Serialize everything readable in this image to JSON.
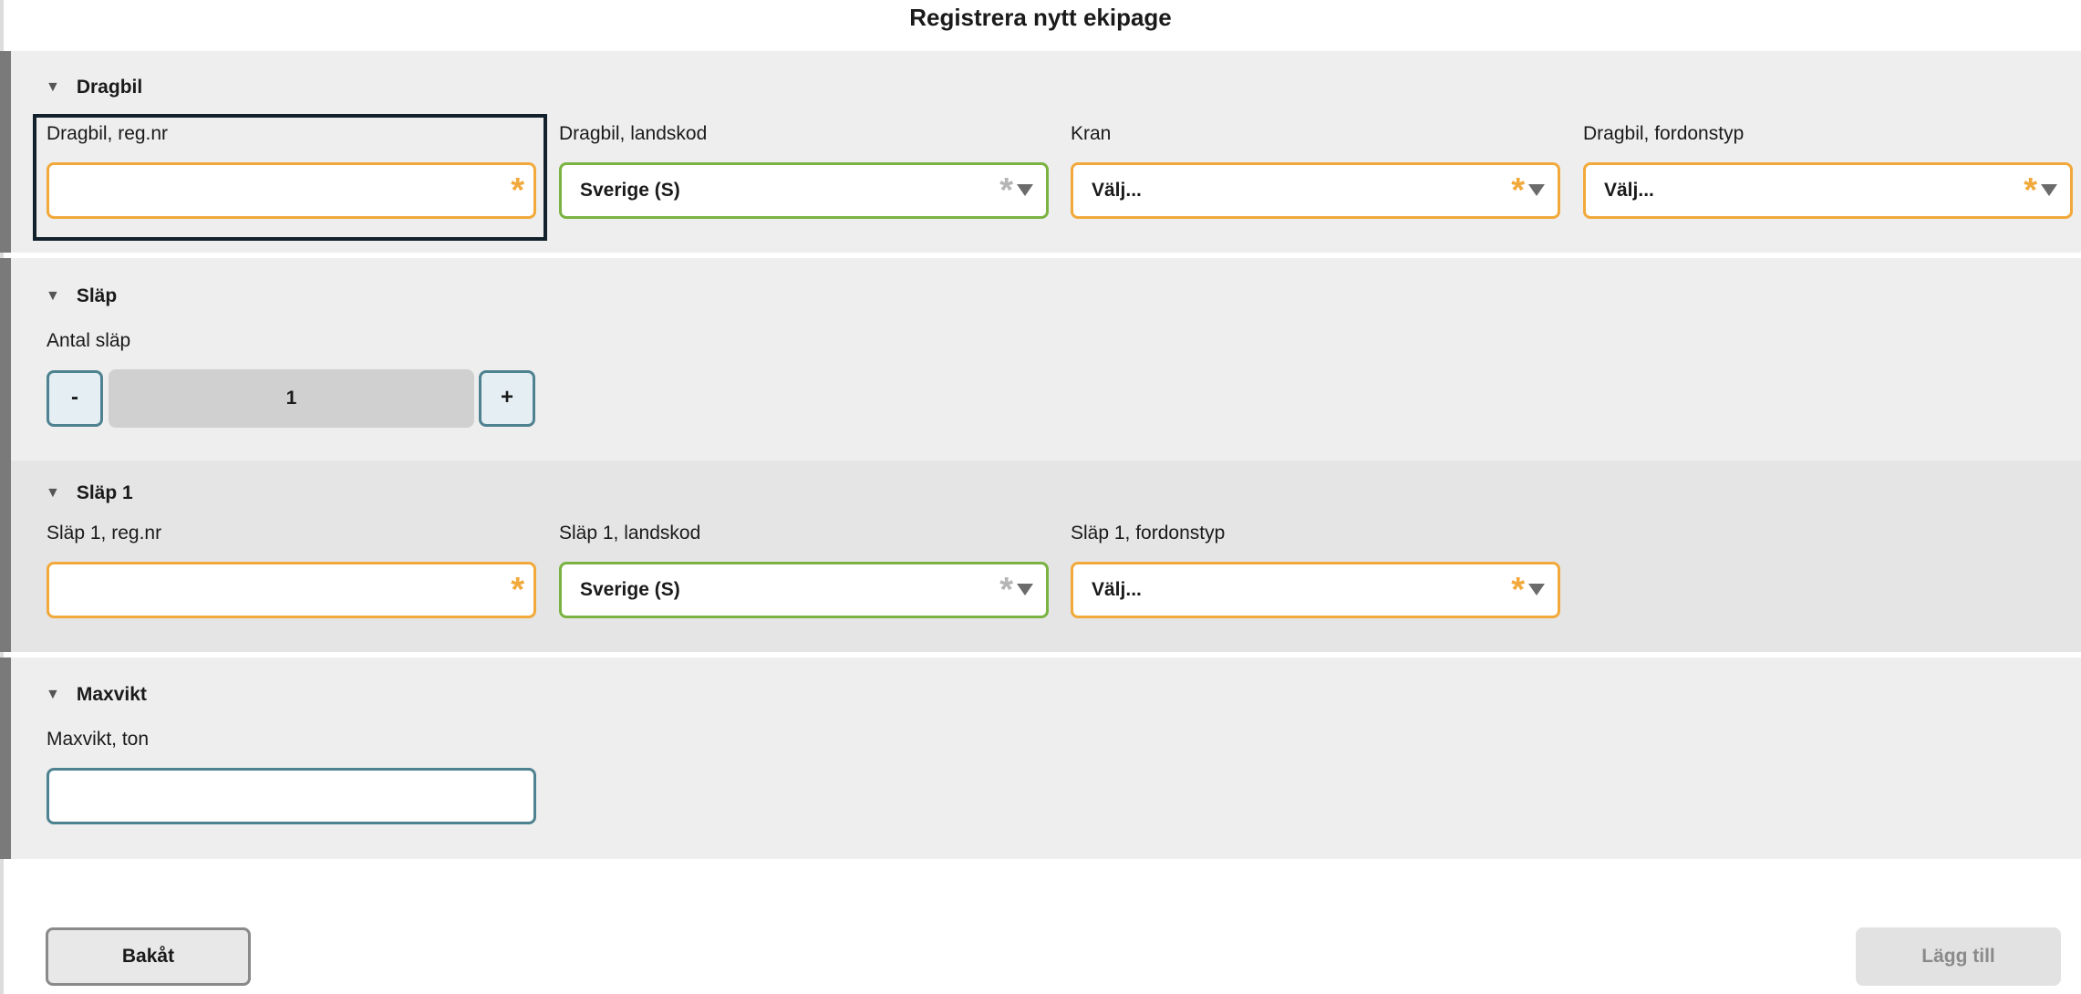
{
  "page": {
    "title": "Registrera nytt ekipage"
  },
  "sections": {
    "dragbil": {
      "title": "Dragbil",
      "regnr_label": "Dragbil, reg.nr",
      "regnr_value": "",
      "landskod_label": "Dragbil, landskod",
      "landskod_value": "Sverige (S)",
      "kran_label": "Kran",
      "kran_value": "Välj...",
      "fordonstyp_label": "Dragbil, fordonstyp",
      "fordonstyp_value": "Välj..."
    },
    "slap": {
      "title": "Släp",
      "antal_label": "Antal släp",
      "minus_label": "-",
      "plus_label": "+",
      "antal_value": "1"
    },
    "slap1": {
      "title": "Släp 1",
      "regnr_label": "Släp 1, reg.nr",
      "regnr_value": "",
      "landskod_label": "Släp 1, landskod",
      "landskod_value": "Sverige (S)",
      "fordonstyp_label": "Släp 1, fordonstyp",
      "fordonstyp_value": "Välj..."
    },
    "maxvikt": {
      "title": "Maxvikt",
      "ton_label": "Maxvikt, ton",
      "ton_value": ""
    }
  },
  "footer": {
    "back_label": "Bakåt",
    "add_label": "Lägg till"
  },
  "glyphs": {
    "required": "*",
    "collapse": "▼"
  },
  "colors": {
    "required_border": "#f2a93b",
    "valid_border": "#7ab342",
    "neutral_border": "#4e8290",
    "focus_ring": "#12212b"
  },
  "icons": {
    "collapse": "chevron-down-icon",
    "dropdown": "dropdown-arrow-icon",
    "required": "required-asterisk-icon"
  }
}
